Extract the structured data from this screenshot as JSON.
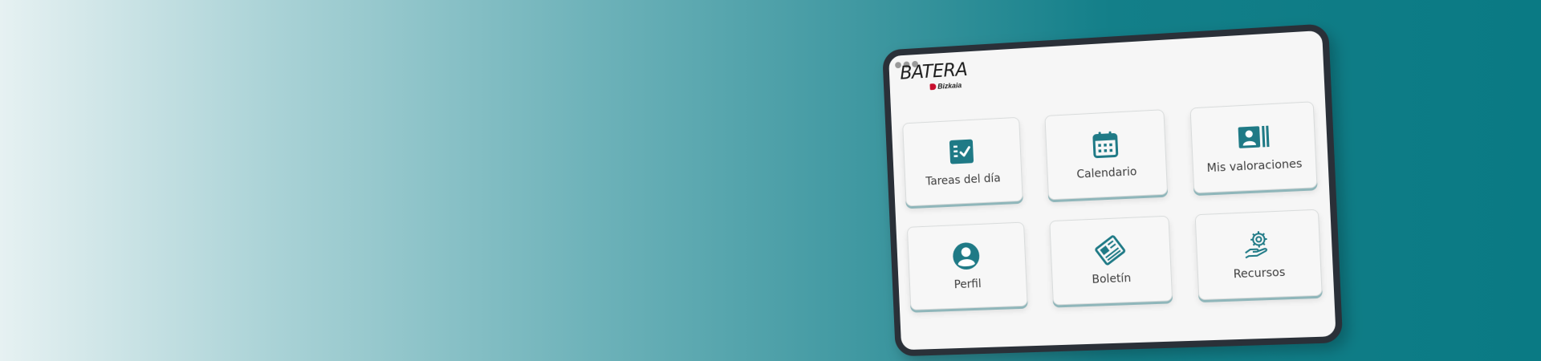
{
  "brand": {
    "name": "BATERA",
    "subtitle": "Bizkaia"
  },
  "colors": {
    "accent": "#1f7a86",
    "frame": "#2a3038",
    "brand_red": "#c8102e"
  },
  "menu": [
    {
      "label": "Tareas del día",
      "icon": "task-list-icon"
    },
    {
      "label": "Calendario",
      "icon": "calendar-icon"
    },
    {
      "label": "Mis valoraciones",
      "icon": "contact-card-icon"
    },
    {
      "label": "Perfil",
      "icon": "user-profile-icon"
    },
    {
      "label": "Boletín",
      "icon": "newsletter-icon"
    },
    {
      "label": "Recursos",
      "icon": "resources-hand-gear-icon"
    }
  ]
}
